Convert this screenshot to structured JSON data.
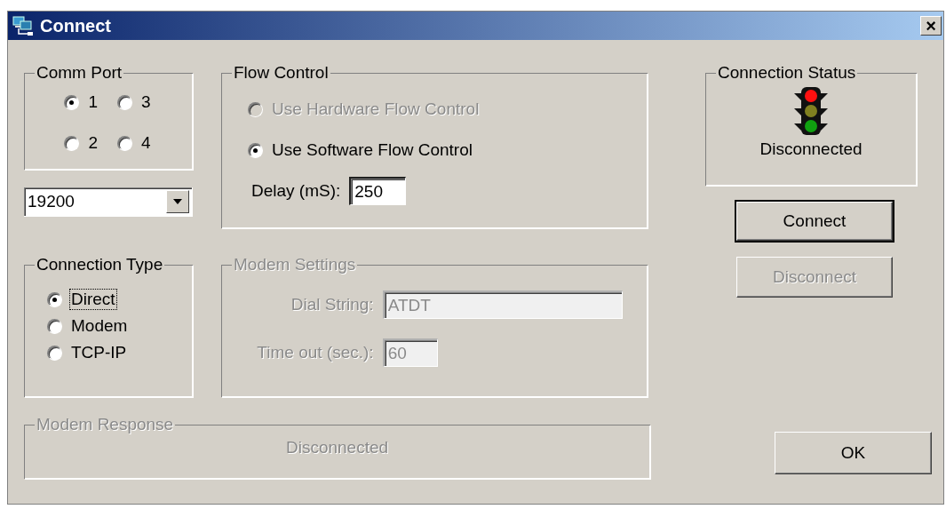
{
  "window": {
    "title": "Connect",
    "close": "×"
  },
  "comm_port": {
    "label": "Comm Port",
    "options": [
      {
        "label": "1",
        "selected": true
      },
      {
        "label": "3",
        "selected": false
      },
      {
        "label": "2",
        "selected": false
      },
      {
        "label": "4",
        "selected": false
      }
    ]
  },
  "baud_rate": {
    "value": "19200"
  },
  "connection_type": {
    "label": "Connection Type",
    "options": [
      {
        "label": "Direct",
        "selected": true,
        "focused": true
      },
      {
        "label": "Modem",
        "selected": false,
        "focused": false
      },
      {
        "label": "TCP-IP",
        "selected": false,
        "focused": false
      }
    ]
  },
  "flow_control": {
    "label": "Flow Control",
    "options": [
      {
        "label": "Use Hardware Flow Control",
        "selected": false,
        "disabled": true
      },
      {
        "label": "Use Software Flow Control",
        "selected": true,
        "disabled": false
      }
    ],
    "delay": {
      "label": "Delay (mS):",
      "value": "250"
    }
  },
  "modem_settings": {
    "label": "Modem Settings",
    "disabled": true,
    "dial_string": {
      "label": "Dial String:",
      "value": "ATDT"
    },
    "timeout": {
      "label": "Time out (sec.):",
      "value": "60"
    }
  },
  "connection_status": {
    "label": "Connection Status",
    "text": "Disconnected"
  },
  "buttons": [
    {
      "label": "Connect",
      "disabled": false,
      "default": true
    },
    {
      "label": "Disconnect",
      "disabled": true,
      "default": false
    }
  ],
  "modem_response": {
    "label": "Modem Response",
    "disabled": true,
    "text": "Disconnected"
  },
  "ok_button": {
    "label": "OK"
  }
}
